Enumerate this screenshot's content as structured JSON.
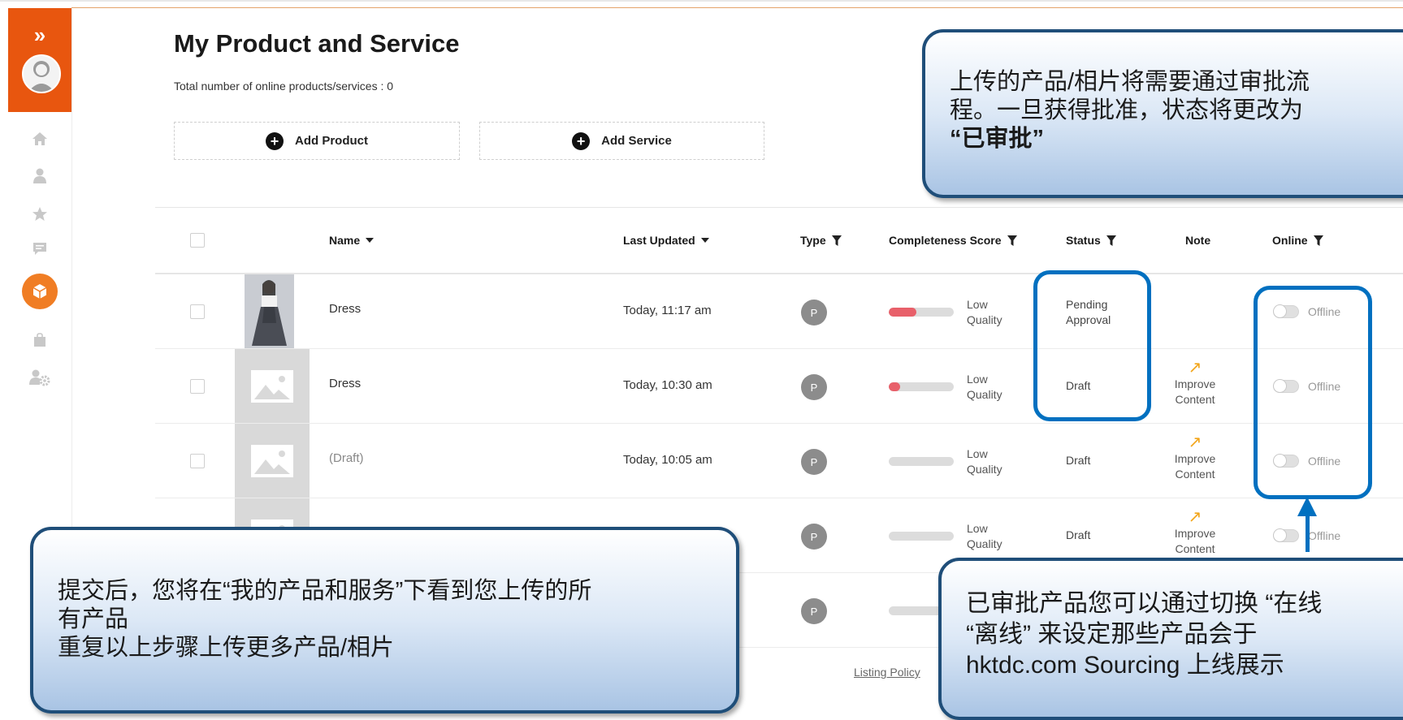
{
  "colors": {
    "brand": "#e8560f",
    "accent": "#f07d24",
    "highlight": "#0070c0",
    "low_quality_bar": "#e8606a"
  },
  "sidebar": {
    "expand_icon": "»",
    "icons": [
      "home-icon",
      "user-icon",
      "star-icon",
      "message-icon",
      "product-icon",
      "bag-icon",
      "user-settings-icon"
    ],
    "active_item": "product-icon"
  },
  "header": {
    "title": "My Product and Service",
    "subtitle": "Total number of online products/services : 0",
    "add_product": "Add Product",
    "add_service": "Add Service"
  },
  "table": {
    "columns": {
      "name": "Name",
      "last_updated": "Last Updated",
      "type": "Type",
      "completeness": "Completeness Score",
      "status": "Status",
      "note": "Note",
      "online": "Online"
    },
    "rows": [
      {
        "name": "Dress",
        "last_updated": "Today, 11:17 am",
        "type": "P",
        "score_fraction": 0.42,
        "quality_line1": "Low",
        "quality_line2": "Quality",
        "status_line1": "Pending",
        "status_line2": "Approval",
        "note_line1": "",
        "note_line2": "",
        "online": "Offline"
      },
      {
        "name": "Dress",
        "last_updated": "Today, 10:30 am",
        "type": "P",
        "score_fraction": 0.18,
        "quality_line1": "Low",
        "quality_line2": "Quality",
        "status_line1": "Draft",
        "status_line2": "",
        "note_line1": "Improve",
        "note_line2": "Content",
        "online": "Offline"
      },
      {
        "name": "(Draft)",
        "last_updated": "Today, 10:05 am",
        "type": "P",
        "score_fraction": 0.0,
        "quality_line1": "Low",
        "quality_line2": "Quality",
        "status_line1": "Draft",
        "status_line2": "",
        "note_line1": "Improve",
        "note_line2": "Content",
        "online": "Offline"
      },
      {
        "name": "",
        "last_updated": "",
        "type": "P",
        "score_fraction": 0.0,
        "quality_line1": "Low",
        "quality_line2": "Quality",
        "status_line1": "Draft",
        "status_line2": "",
        "note_line1": "Improve",
        "note_line2": "Content",
        "online": "Offline"
      },
      {
        "name": "",
        "last_updated": "",
        "type": "P",
        "score_fraction": 0.0
      }
    ]
  },
  "footer": {
    "listing_policy": "Listing Policy"
  },
  "overlays": {
    "top_line1": "上传的产品/相片将需要通过审批流",
    "top_line2": "程。一旦获得批准，状态将更改为",
    "top_line3": "“已审批”",
    "left_line1": "提交后，您将在“我的产品和服务”下看到您上传的所",
    "left_line2": "有产品",
    "left_line3": "重复以上步骤上传更多产品/相片",
    "right_line1": "已审批产品您可以通过切换 “在线",
    "right_line2": "“离线” 来设定那些产品会于",
    "right_line3": "hktdc.com Sourcing 上线展示"
  }
}
